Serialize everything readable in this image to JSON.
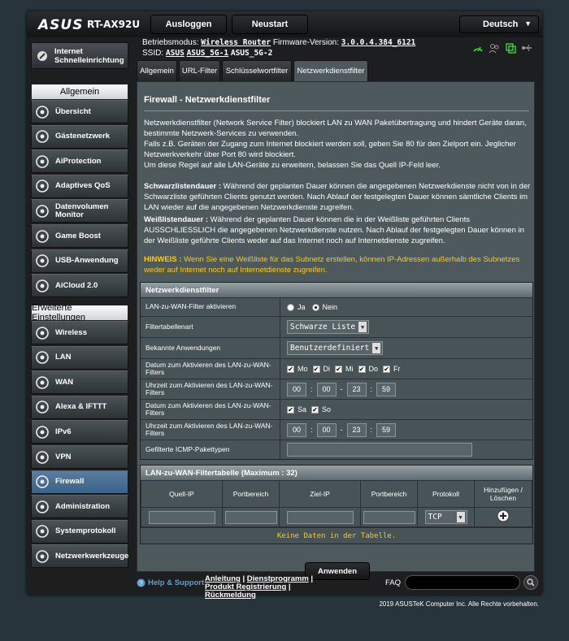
{
  "header": {
    "logo": "ASUS",
    "model": "RT-AX92U",
    "logout_label": "Ausloggen",
    "restart_label": "Neustart",
    "language": "Deutsch"
  },
  "info": {
    "mode_label": "Betriebsmodus:",
    "mode_value": "Wireless Router",
    "fw_label": "Firmware-Version:",
    "fw_value": "3.0.0.4.384_6121",
    "ssid_label": "SSID:",
    "ssid1": "ASUS",
    "ssid2": "ASUS_5G-1",
    "ssid3": "ASUS_5G-2"
  },
  "sidebar": {
    "qis_label": "Internet Schnelleinrichtung",
    "general_title": "Allgemein",
    "general_items": [
      {
        "label": "Übersicht",
        "icon": "network-map-icon"
      },
      {
        "label": "Gästenetzwerk",
        "icon": "guest-network-icon"
      },
      {
        "label": "AiProtection",
        "icon": "aiprotection-icon"
      },
      {
        "label": "Adaptives QoS",
        "icon": "qos-icon"
      },
      {
        "label": "Datenvolumen Monitor",
        "icon": "traffic-monitor-icon"
      },
      {
        "label": "Game Boost",
        "icon": "gamepad-icon"
      },
      {
        "label": "USB-Anwendung",
        "icon": "usb-icon"
      },
      {
        "label": "AiCloud 2.0",
        "icon": "cloud-icon"
      }
    ],
    "advanced_title": "Erweiterte Einstellungen",
    "advanced_items": [
      {
        "label": "Wireless",
        "icon": "wireless-icon"
      },
      {
        "label": "LAN",
        "icon": "lan-icon"
      },
      {
        "label": "WAN",
        "icon": "wan-globe-icon"
      },
      {
        "label": "Alexa & IFTTT",
        "icon": "alexa-icon"
      },
      {
        "label": "IPv6",
        "icon": "ipv6-icon"
      },
      {
        "label": "VPN",
        "icon": "vpn-icon"
      },
      {
        "label": "Firewall",
        "icon": "firewall-icon"
      },
      {
        "label": "Administration",
        "icon": "administration-icon"
      },
      {
        "label": "Systemprotokoll",
        "icon": "system-log-icon"
      },
      {
        "label": "Netzwerkwerkzeuge",
        "icon": "network-tools-icon"
      }
    ]
  },
  "tabs": [
    "Allgemein",
    "URL-Filter",
    "Schlüsselwortfilter",
    "Netzwerkdienstfilter"
  ],
  "page": {
    "title": "Firewall - Netzwerkdienstfilter",
    "p1": "Netzwerkdienstfilter (Network Service Filter) blockiert LAN zu WAN Paketübertragung und hindert Geräte daran, bestimmte Netzwerk-Services zu verwenden.",
    "p2": "Falls z.B. Geräten der Zugang zum Internet blockiert werden soll, geben Sie 80 für den Zielport ein. Jeglicher Netzwerkverkehr über Port 80 wird blockiert.",
    "p3": "Um diese Regel auf alle LAN-Geräte zu erweitern, belassen Sie das Quell IP-Feld leer.",
    "black_label": "Schwarzlistendauer :",
    "black_text": " Während der geplanten Dauer können die angegebenen Netzwerkdienste nicht von in der Schwarzliste geführten Clients genutzt werden. Nach Ablauf der festgelegten Dauer können sämtliche Clients im LAN wieder auf die angegebenen Netzwerkdienste zugreifen.",
    "white_label": "Weißlistendauer :",
    "white_text": " Während der geplanten Dauer können die in der Weißliste geführten Clients AUSSCHLIESSLICH die angegebenen Netzwerkdienste nutzen. Nach Ablauf der festgelegten Dauer können in der Weißliste geführte Clients weder auf das Internet noch auf Internetdienste zugreifen.",
    "hint_label": "HINWEIS :",
    "hint_text": " Wenn Sie eine Weißliste für das Subnetz erstellen, können IP-Adressen außerhalb des Subnetzes weder auf Internet noch auf Internetdienste zugreifen."
  },
  "filter": {
    "head": "Netzwerkdienstfilter",
    "enable_label": "LAN-zu-WAN-Filter aktivieren",
    "yes": "Ja",
    "no": "Nein",
    "type_label": "Filtertabellenart",
    "type_value": "Schwarze Liste",
    "apps_label": "Bekannte Anwendungen",
    "apps_value": "Benutzerdefiniert",
    "days1_label": "Datum zum Aktivieren des LAN-zu-WAN-Filters",
    "days1": [
      "Mo",
      "Di",
      "Mi",
      "Do",
      "Fr"
    ],
    "time1_label": "Uhrzeit zum Aktivieren des LAN-zu-WAN-Filters",
    "time1": [
      "00",
      "00",
      "23",
      "59"
    ],
    "days2_label": "Datum zum Aktivieren des LAN-zu-WAN-Filters",
    "days2": [
      "Sa",
      "So"
    ],
    "time2_label": "Uhrzeit zum Aktivieren des LAN-zu-WAN-Filters",
    "time2": [
      "00",
      "00",
      "23",
      "59"
    ],
    "icmp_label": "Gefilterte ICMP-Pakettypen",
    "sep": "-"
  },
  "table": {
    "head": "LAN-zu-WAN-Filtertabelle (Maximum : 32)",
    "cols": [
      "Quell-IP",
      "Portbereich",
      "Ziel-IP",
      "Portbereich",
      "Protokoll",
      "Hinzufügen / Löschen"
    ],
    "protocol": "TCP",
    "empty": "Keine Daten in der Tabelle."
  },
  "apply_label": "Anwenden",
  "footer": {
    "help": "Help & Support",
    "l1": "Anleitung",
    "l2": "Dienstprogramm",
    "l3": "Produkt Registrierung",
    "l4": "Rückmeldung",
    "faq": "FAQ",
    "copyright": "2019 ASUSTeK Computer Inc. Alle Rechte vorbehalten."
  }
}
